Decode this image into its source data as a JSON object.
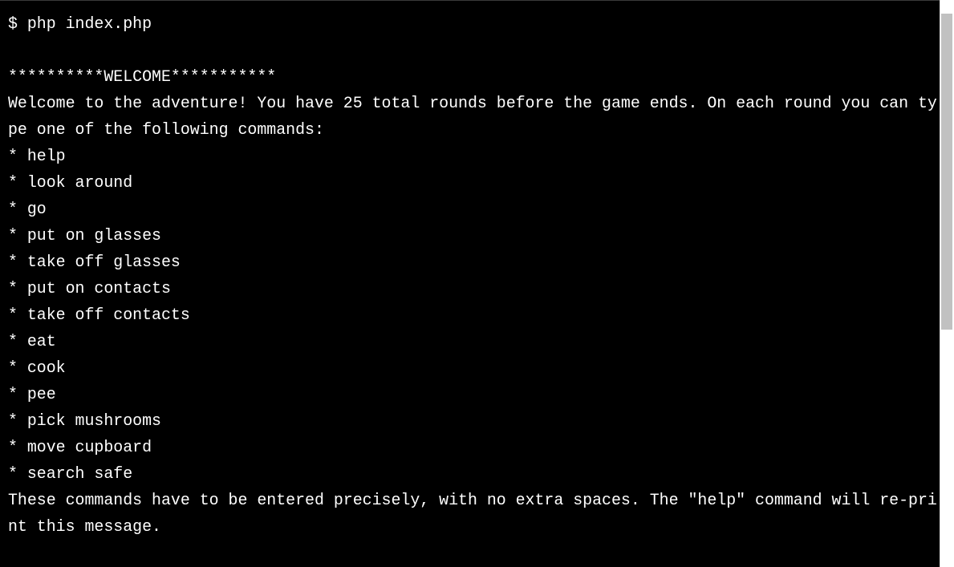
{
  "terminal": {
    "lines": [
      "$ php index.php",
      "",
      "**********WELCOME***********",
      "Welcome to the adventure! You have 25 total rounds before the game ends. On each round you can ty",
      "pe one of the following commands:",
      "* help",
      "* look around",
      "* go",
      "* put on glasses",
      "* take off glasses",
      "* put on contacts",
      "* take off contacts",
      "* eat",
      "* cook",
      "* pee",
      "* pick mushrooms",
      "* move cupboard",
      "* search safe",
      "These commands have to be entered precisely, with no extra spaces. The \"help\" command will re-pri",
      "nt this message."
    ]
  },
  "colors": {
    "background": "#000000",
    "text": "#ffffff",
    "scrollbar_track": "#ffffff",
    "scrollbar_thumb": "#c1c1c1"
  }
}
